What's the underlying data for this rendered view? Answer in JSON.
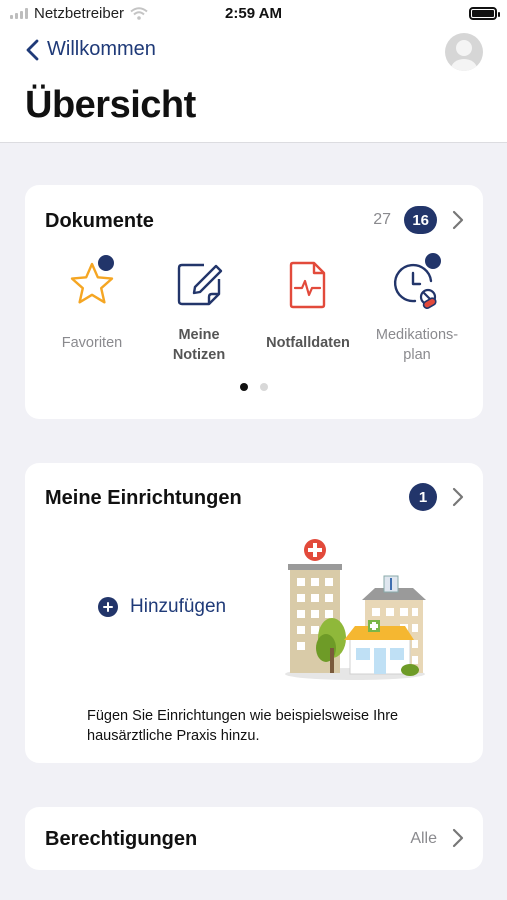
{
  "status_bar": {
    "carrier": "Netzbetreiber",
    "time": "2:59 AM"
  },
  "header": {
    "back_label": "Willkommen",
    "title": "Übersicht"
  },
  "documents": {
    "title": "Dokumente",
    "count": "27",
    "badge": "16",
    "items": [
      {
        "label": "Favoriten",
        "icon": "star-icon",
        "color": "#f5a623"
      },
      {
        "label": "Meine\nNotizen",
        "icon": "note-edit-icon",
        "color": "#22356a"
      },
      {
        "label": "Notfalldaten",
        "icon": "emergency-document-icon",
        "color": "#e24a3b"
      },
      {
        "label": "Medikations-\nplan",
        "icon": "medication-clock-icon",
        "color": "#22356a"
      }
    ],
    "page_count": 2,
    "active_page": 1
  },
  "facilities": {
    "title": "Meine Einrichtungen",
    "badge": "1",
    "add_label": "Hinzufügen",
    "hint": "Fügen Sie Einrichtungen wie beispielsweise Ihre hausärztliche Praxis hinzu."
  },
  "permissions": {
    "title": "Berechtigungen",
    "filter": "Alle"
  },
  "colors": {
    "accent": "#22356a",
    "link": "#1f3a78",
    "background": "#f1f1f6"
  }
}
